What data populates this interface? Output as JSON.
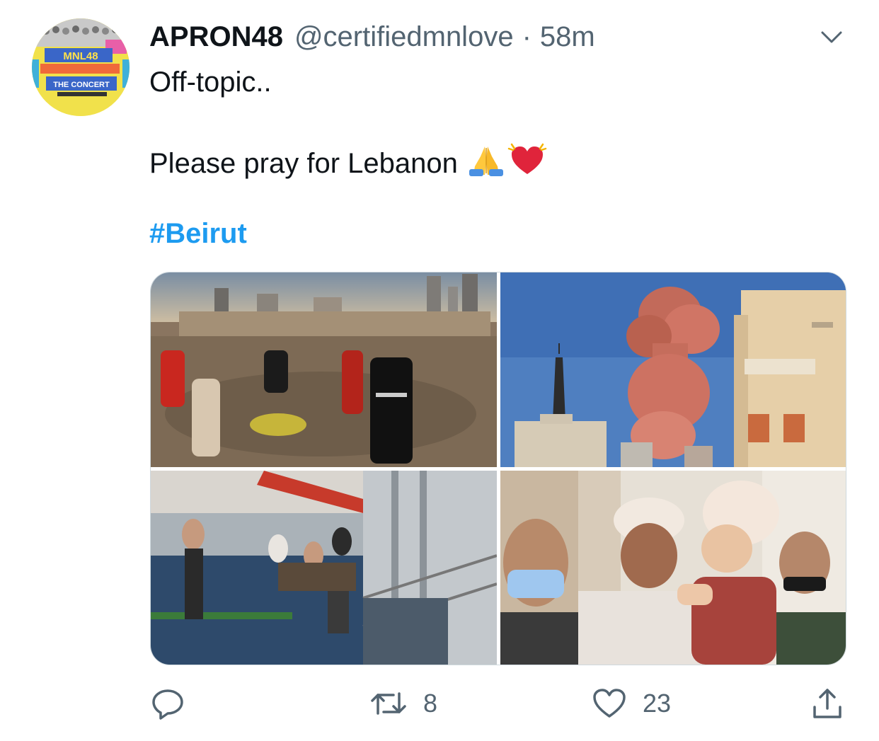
{
  "tweet": {
    "display_name": "APRON48",
    "handle": "@certifiedmnlove",
    "separator": "·",
    "time": "58m",
    "text_line1": "Off-topic..",
    "text_line2": "Please pray for Lebanon",
    "hashtag": "#Beirut"
  },
  "avatar": {
    "badge_top": "MNL48",
    "badge_bottom": "THE CONCERT"
  },
  "media": [
    {
      "icon": "rescue-scene-photo"
    },
    {
      "icon": "explosion-cloud-photo"
    },
    {
      "icon": "ship-rescue-photo"
    },
    {
      "icon": "injured-man-child-photo"
    }
  ],
  "actions": {
    "reply_count": "",
    "retweet_count": "8",
    "like_count": "23"
  },
  "colors": {
    "accent": "#1d9bf0",
    "muted": "#536471",
    "text": "#0f1419",
    "heart_emoji": "#e0243b"
  }
}
